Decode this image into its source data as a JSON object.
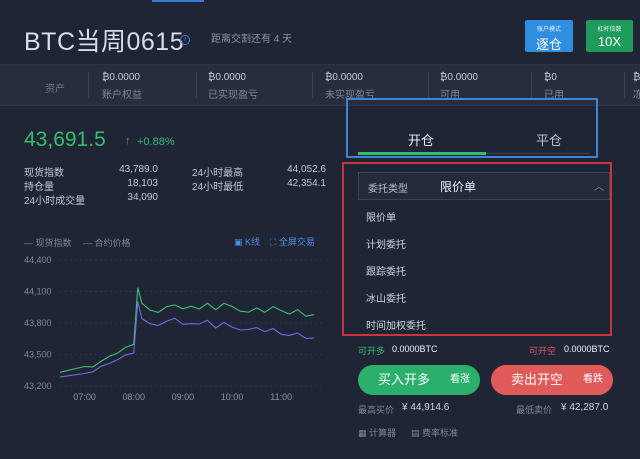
{
  "header": {
    "title": "BTC当周0615",
    "settlement_text": "距离交割还有 4 天",
    "margin_mode": {
      "small": "账户模式",
      "label": "逐仓"
    },
    "leverage": {
      "small": "杠杆倍数",
      "label": "10X"
    }
  },
  "assets": {
    "label": "资产",
    "columns": [
      {
        "value": "₿0.0000",
        "label": "账户权益"
      },
      {
        "value": "₿0.0000",
        "label": "已实现盈亏"
      },
      {
        "value": "₿0.0000",
        "label": "未实现盈亏"
      },
      {
        "value": "₿0.0000",
        "label": "可用"
      },
      {
        "value": "₿0",
        "label": "已用"
      },
      {
        "value": "₿",
        "label": "冻"
      }
    ]
  },
  "ticker": {
    "price": "43,691.5",
    "arrow": "↑",
    "change": "+0.88%",
    "stats": [
      {
        "label": "现货指数",
        "value": "43,789.0"
      },
      {
        "label": "持仓量",
        "value": "18,103"
      },
      {
        "label": "24小时成交量",
        "value": "34,090"
      },
      {
        "label": "24小时最高",
        "value": "44,052.6"
      },
      {
        "label": "24小时最低",
        "value": "42,354.1"
      }
    ]
  },
  "chart_controls": {
    "legend_index": "现货指数",
    "legend_contract": "合约价格",
    "kline": "K线",
    "fullscreen": "全屏交易"
  },
  "chart_data": {
    "type": "line",
    "x": [
      "06:30",
      "07:00",
      "07:10",
      "07:20",
      "07:30",
      "07:40",
      "07:50",
      "08:00",
      "08:05",
      "08:10",
      "08:20",
      "08:30",
      "08:40",
      "08:50",
      "09:00",
      "09:10",
      "09:20",
      "09:30",
      "09:40",
      "09:50",
      "10:00",
      "10:10",
      "10:20",
      "10:30",
      "10:40",
      "10:50",
      "11:00",
      "11:10",
      "11:20",
      "11:30",
      "11:40"
    ],
    "xticks": [
      "07:00",
      "08:00",
      "09:00",
      "10:00",
      "11:00"
    ],
    "yticks": [
      "44,400",
      "44,100",
      "43,800",
      "43,500",
      "43,200"
    ],
    "ylim": [
      43200,
      44400
    ],
    "series": [
      {
        "color": "#3fc06f",
        "values": [
          43330,
          43380,
          43390,
          43430,
          43480,
          43520,
          43560,
          43600,
          44140,
          43980,
          43930,
          43900,
          43950,
          43980,
          43930,
          43960,
          43940,
          43980,
          43930,
          43990,
          43950,
          43920,
          43900,
          43940,
          43910,
          43950,
          43920,
          43890,
          43920,
          43870,
          43880
        ]
      },
      {
        "color": "#6a6fe0",
        "values": [
          43280,
          43320,
          43340,
          43380,
          43420,
          43450,
          43490,
          43520,
          44000,
          43840,
          43800,
          43770,
          43820,
          43850,
          43780,
          43800,
          43790,
          43820,
          43760,
          43800,
          43760,
          43740,
          43730,
          43760,
          43720,
          43740,
          43700,
          43680,
          43700,
          43660,
          43650
        ]
      }
    ]
  },
  "trade": {
    "tab_open": "开仓",
    "tab_close": "平仓",
    "order_type_label": "委托类型",
    "order_type_value": "限价单",
    "order_options": [
      "限价单",
      "计划委托",
      "跟踪委托",
      "冰山委托",
      "时间加权委托"
    ],
    "avail_open_label": "可开多",
    "avail_open_value": "0.0000BTC",
    "avail_short_label": "可开空",
    "avail_short_value": "0.0000BTC",
    "buy_label": "买入开多",
    "buy_sub": "看涨",
    "sell_label": "卖出开空",
    "sell_sub": "看跌",
    "best_bid_label": "最高买价",
    "best_bid_value": "¥ 44,914.6",
    "best_ask_label": "最低卖价",
    "best_ask_value": "¥ 42,287.0",
    "calculator": "计算器",
    "fee": "费率标准"
  }
}
